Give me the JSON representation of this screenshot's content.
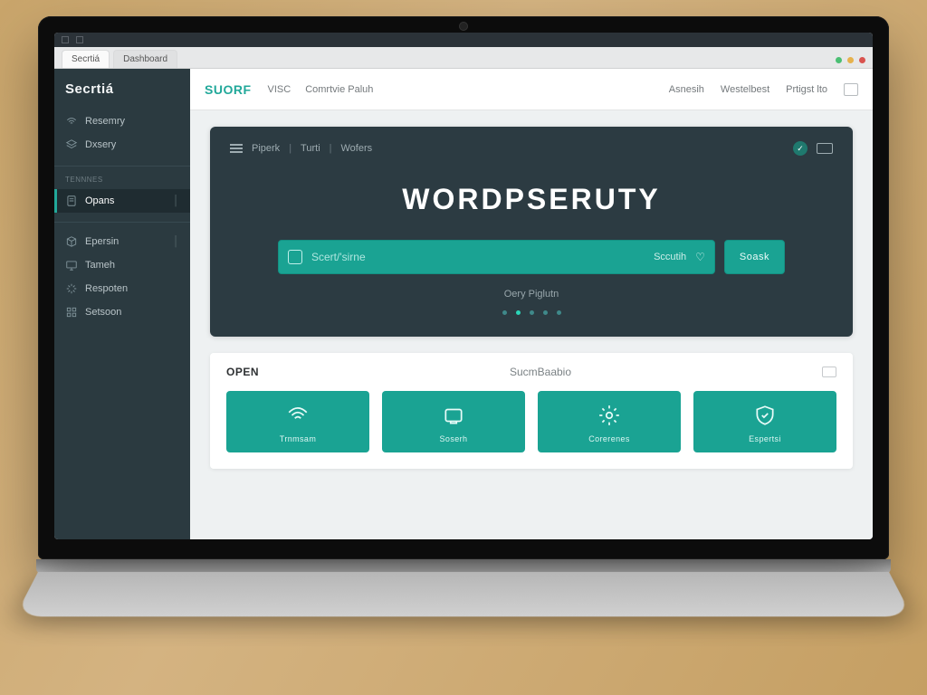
{
  "os": {
    "hint": ""
  },
  "browser": {
    "tabs": [
      "Secrtiá",
      "Dashboard"
    ]
  },
  "sidebar": {
    "brand": "Secrtiá",
    "groups": [
      {
        "label": "",
        "items": [
          {
            "label": "Resemry"
          },
          {
            "label": "Dxsery"
          }
        ]
      },
      {
        "label": "Tennnes",
        "items": [
          {
            "label": "Opans"
          }
        ]
      },
      {
        "label": "",
        "items": [
          {
            "label": "Epersin"
          },
          {
            "label": "Tameh"
          },
          {
            "label": "Respoten"
          },
          {
            "label": "Setsoon"
          }
        ]
      }
    ]
  },
  "topbar": {
    "logo": "SUORF",
    "nav": [
      "VISC",
      "Comrtvie Paluh"
    ],
    "right": [
      "Asnesih",
      "Westelbest",
      "Prtigst lto"
    ]
  },
  "hero": {
    "crumbs": [
      "Piperk",
      "Turti",
      "Wofers"
    ],
    "title": "WORDPSERUTY",
    "search_placeholder": "Scert/'sirne",
    "search_mid": "Sccutih",
    "button": "Soask",
    "subtitle": "Oery Piglutn"
  },
  "panel": {
    "open": "OPEN",
    "center": "SucmBaabio",
    "tiles": [
      {
        "label": "Trnmsam"
      },
      {
        "label": "Soserh"
      },
      {
        "label": "Corerenes"
      },
      {
        "label": "Espertsi"
      }
    ]
  }
}
